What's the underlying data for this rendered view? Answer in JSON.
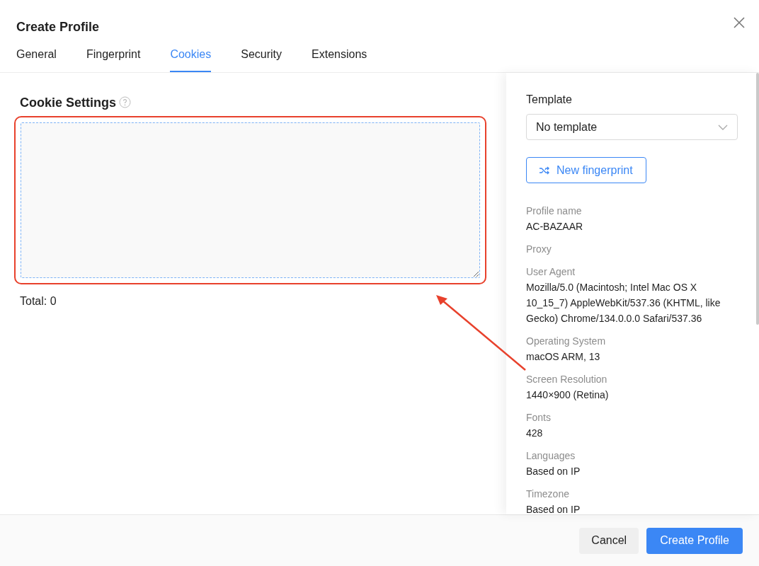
{
  "dialog": {
    "title": "Create Profile"
  },
  "tabs": [
    {
      "label": "General",
      "selected": false
    },
    {
      "label": "Fingerprint",
      "selected": false
    },
    {
      "label": "Cookies",
      "selected": true
    },
    {
      "label": "Security",
      "selected": false
    },
    {
      "label": "Extensions",
      "selected": false
    }
  ],
  "cookie_settings": {
    "title": "Cookie Settings",
    "total": "Total: 0"
  },
  "sidebar": {
    "template_label": "Template",
    "template_value": "No template",
    "new_fingerprint": "New fingerprint",
    "fields": [
      {
        "label": "Profile name",
        "value": "AC-BAZAAR"
      },
      {
        "label": "Proxy"
      },
      {
        "label": "User Agent",
        "value": "Mozilla/5.0 (Macintosh; Intel Mac OS X 10_15_7) AppleWebKit/537.36 (KHTML, like Gecko) Chrome/134.0.0.0 Safari/537.36"
      },
      {
        "label": "Operating System",
        "value": "macOS ARM, 13"
      },
      {
        "label": "Screen Resolution",
        "value": "1440×900 (Retina)"
      },
      {
        "label": "Fonts",
        "value": "428"
      },
      {
        "label": "Languages",
        "value": "Based on IP"
      },
      {
        "label": "Timezone",
        "value": "Based on IP"
      }
    ]
  },
  "footer": {
    "buttons": [
      {
        "label": "Cancel",
        "kind": "secondary"
      },
      {
        "label": "Create Profile",
        "kind": "primary"
      }
    ]
  }
}
